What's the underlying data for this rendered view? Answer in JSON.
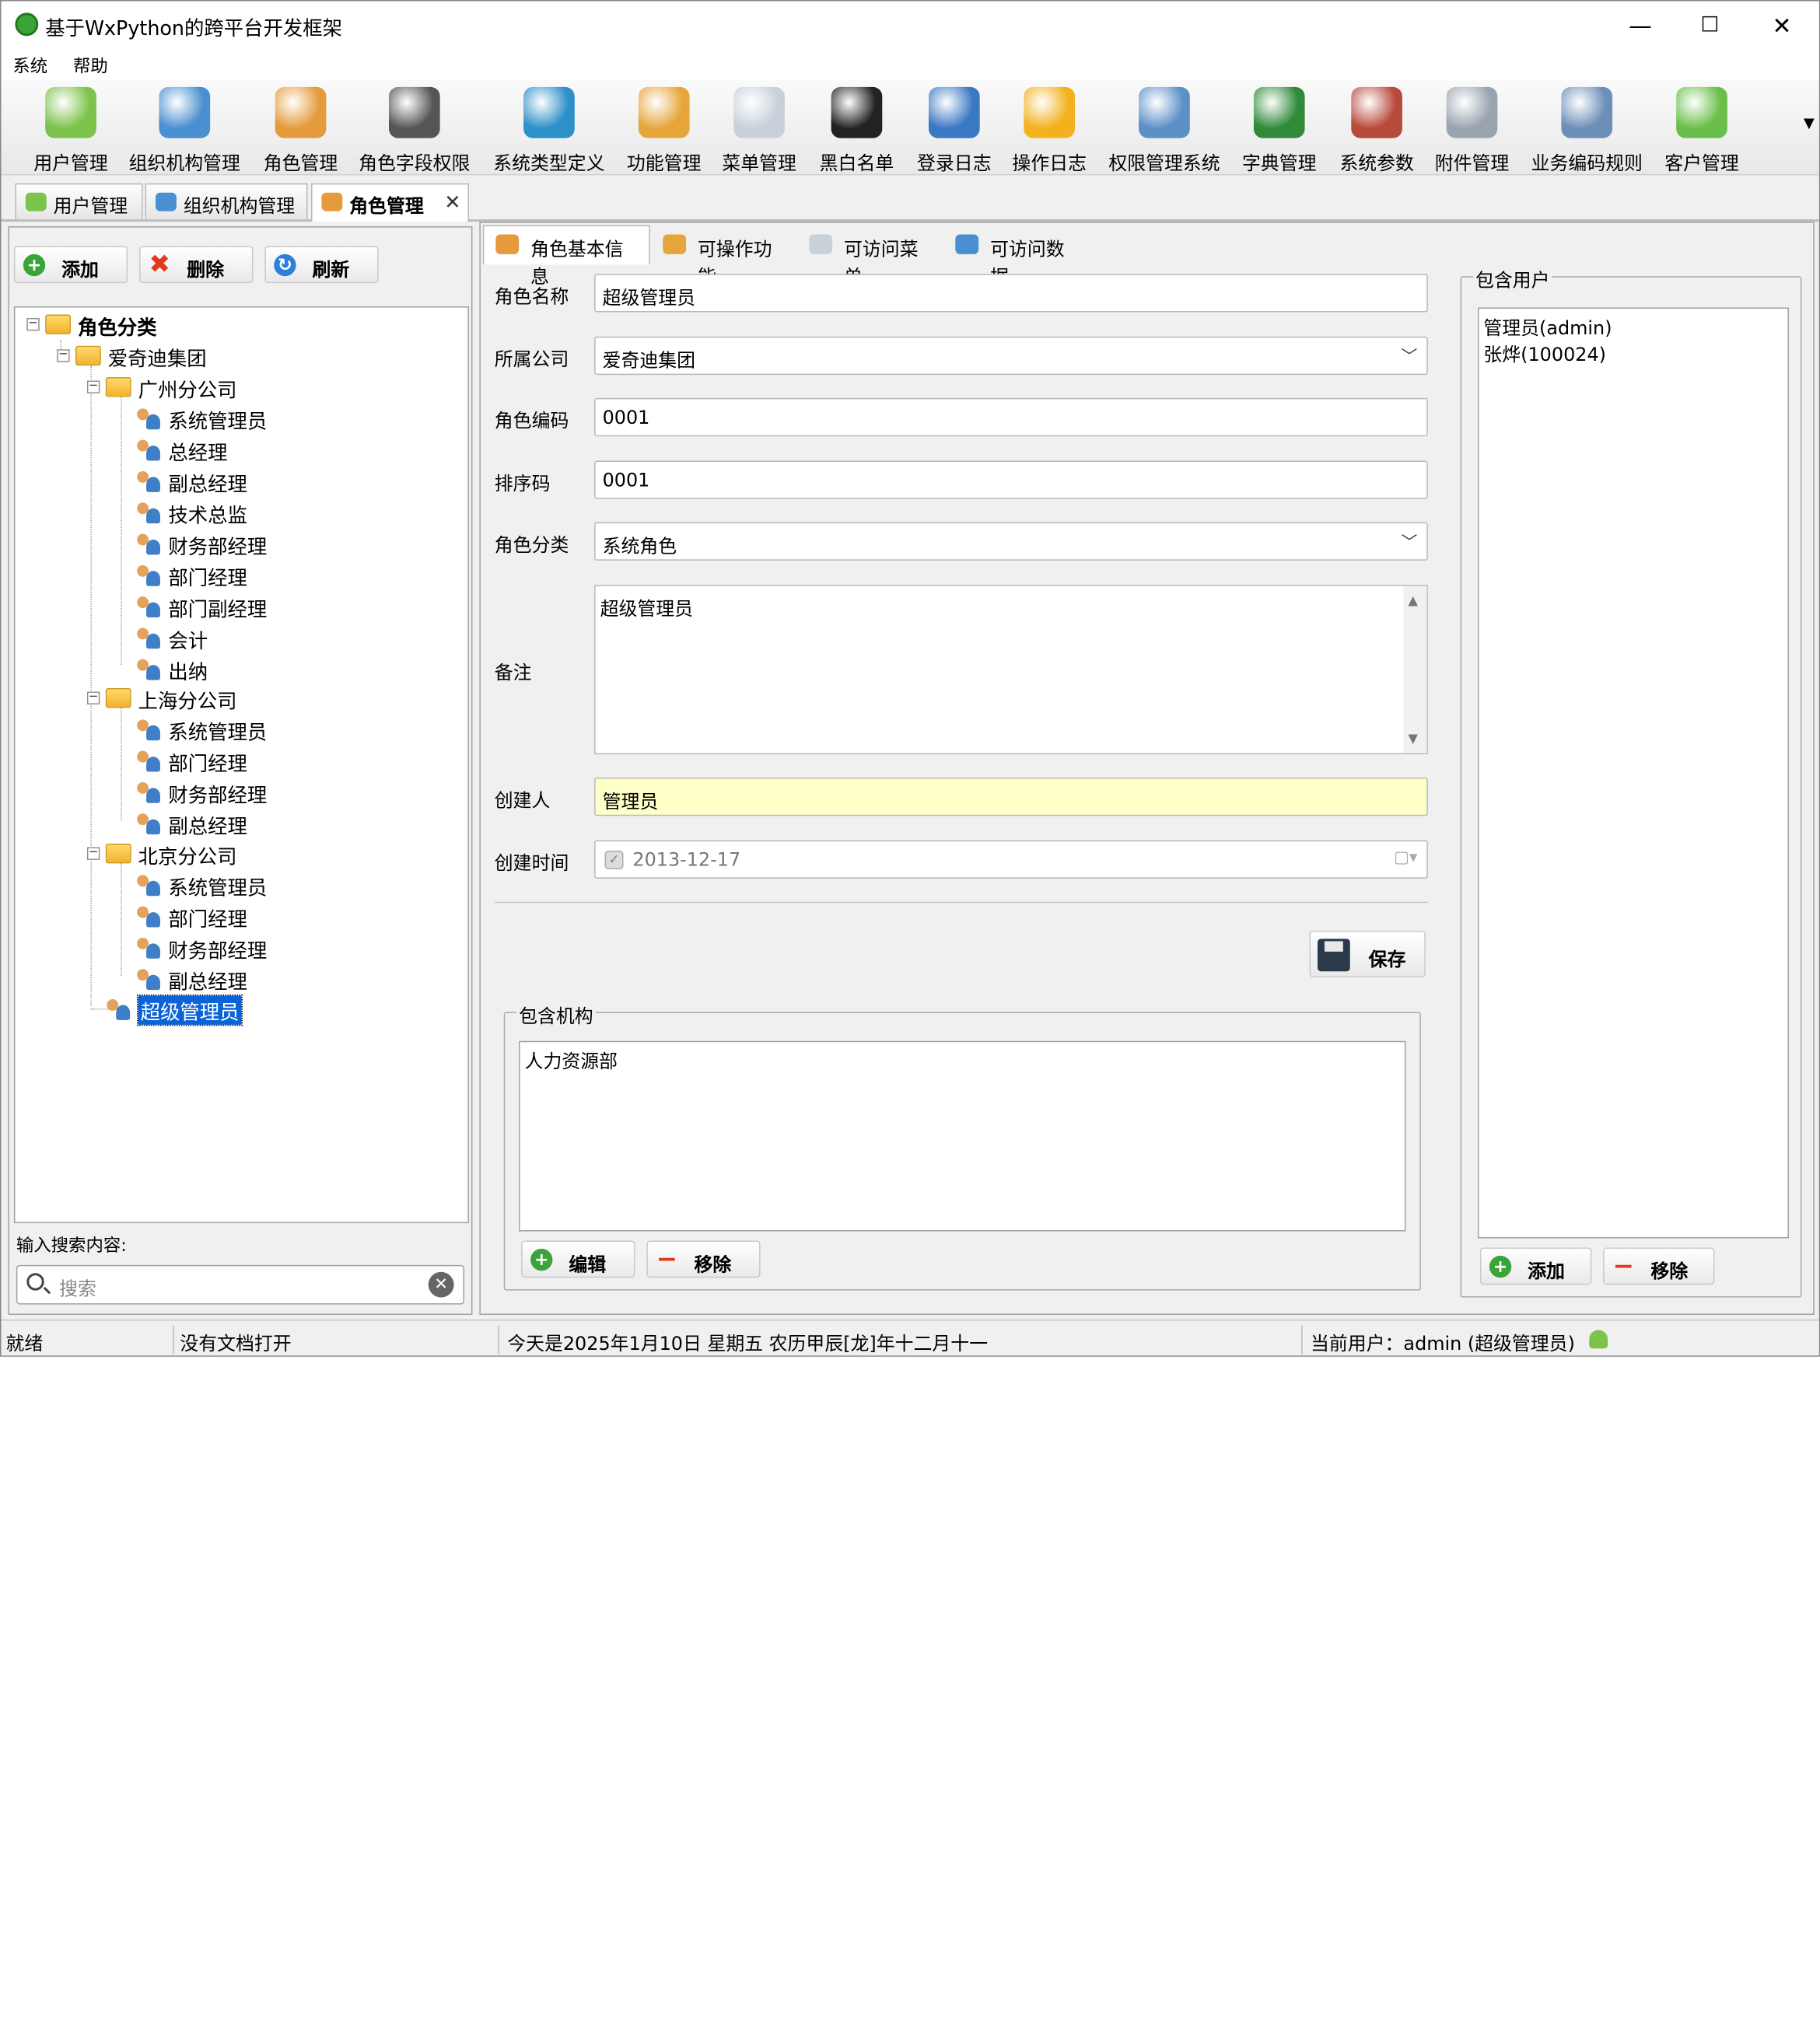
{
  "window": {
    "title": "基于WxPython的跨平台开发框架",
    "minimize": "—",
    "maximize": "☐",
    "close": "✕"
  },
  "menu": [
    "系统",
    "帮助"
  ],
  "toolbar": [
    {
      "label": "用户管理",
      "icon": "user-icon",
      "color": "#7cc34b"
    },
    {
      "label": "组织机构管理",
      "icon": "org-chart-icon",
      "color": "#4a8fd0"
    },
    {
      "label": "角色管理",
      "icon": "role-icon",
      "color": "#e59a3b"
    },
    {
      "label": "角色字段权限",
      "icon": "traffic-light-icon",
      "color": "#555555"
    },
    {
      "label": "系统类型定义",
      "icon": "monitor-icon",
      "color": "#2d90c8"
    },
    {
      "label": "功能管理",
      "icon": "key-icon",
      "color": "#e6a53a"
    },
    {
      "label": "菜单管理",
      "icon": "menu-doc-icon",
      "color": "#c8d1da"
    },
    {
      "label": "黑白名单",
      "icon": "person-dark-icon",
      "color": "#222222"
    },
    {
      "label": "登录日志",
      "icon": "log-list-icon",
      "color": "#3a78c4"
    },
    {
      "label": "操作日志",
      "icon": "warning-icon",
      "color": "#f3b21d"
    },
    {
      "label": "权限管理系统",
      "icon": "computer-key-icon",
      "color": "#5c90c6"
    },
    {
      "label": "字典管理",
      "icon": "book-icon",
      "color": "#2f8a3a"
    },
    {
      "label": "系统参数",
      "icon": "tools-icon",
      "color": "#b84a3c"
    },
    {
      "label": "附件管理",
      "icon": "paperclip-icon",
      "color": "#9aa4b0"
    },
    {
      "label": "业务编码规则",
      "icon": "calculator-icon",
      "color": "#6c8fb8"
    },
    {
      "label": "客户管理",
      "icon": "customers-icon",
      "color": "#6abf4b"
    }
  ],
  "doc_tabs": [
    {
      "label": "用户管理",
      "icon": "user-icon"
    },
    {
      "label": "组织机构管理",
      "icon": "org-chart-icon"
    },
    {
      "label": "角色管理",
      "icon": "role-icon",
      "active": true
    }
  ],
  "left": {
    "buttons": {
      "add": "添加",
      "delete": "删除",
      "refresh": "刷新"
    },
    "tree": {
      "root": "角色分类",
      "group": "爱奇迪集团",
      "branches": [
        {
          "name": "广州分公司",
          "roles": [
            "系统管理员",
            "总经理",
            "副总经理",
            "技术总监",
            "财务部经理",
            "部门经理",
            "部门副经理",
            "会计",
            "出纳"
          ]
        },
        {
          "name": "上海分公司",
          "roles": [
            "系统管理员",
            "部门经理",
            "财务部经理",
            "副总经理"
          ]
        },
        {
          "name": "北京分公司",
          "roles": [
            "系统管理员",
            "部门经理",
            "财务部经理",
            "副总经理"
          ]
        }
      ],
      "selected": "超级管理员"
    },
    "search_label": "输入搜索内容:",
    "search_placeholder": "搜索"
  },
  "inner_tabs": [
    "角色基本信息",
    "可操作功能",
    "可访问菜单",
    "可访问数据"
  ],
  "form": {
    "name_label": "角色名称",
    "name_value": "超级管理员",
    "company_label": "所属公司",
    "company_value": "爱奇迪集团",
    "code_label": "角色编码",
    "code_value": "0001",
    "sort_label": "排序码",
    "sort_value": "0001",
    "category_label": "角色分类",
    "category_value": "系统角色",
    "note_label": "备注",
    "note_value": "超级管理员",
    "creator_label": "创建人",
    "creator_value": "管理员",
    "created_label": "创建时间",
    "created_value": "2013-12-17",
    "save": "保存",
    "colors": {
      "creator_bg": "#ffffc8",
      "selection": "#0a64d8"
    }
  },
  "orgs_box": {
    "caption": "包含机构",
    "items": [
      "人力资源部"
    ],
    "edit": "编辑",
    "remove": "移除"
  },
  "users_box": {
    "caption": "包含用户",
    "items": [
      "管理员(admin)",
      "张烨(100024)"
    ],
    "add": "添加",
    "remove": "移除"
  },
  "status": {
    "ready": "就绪",
    "doc": "没有文档打开",
    "date": "今天是2025年1月10日 星期五 农历甲辰[龙]年十二月十一",
    "user": "当前用户：admin (超级管理员)"
  }
}
